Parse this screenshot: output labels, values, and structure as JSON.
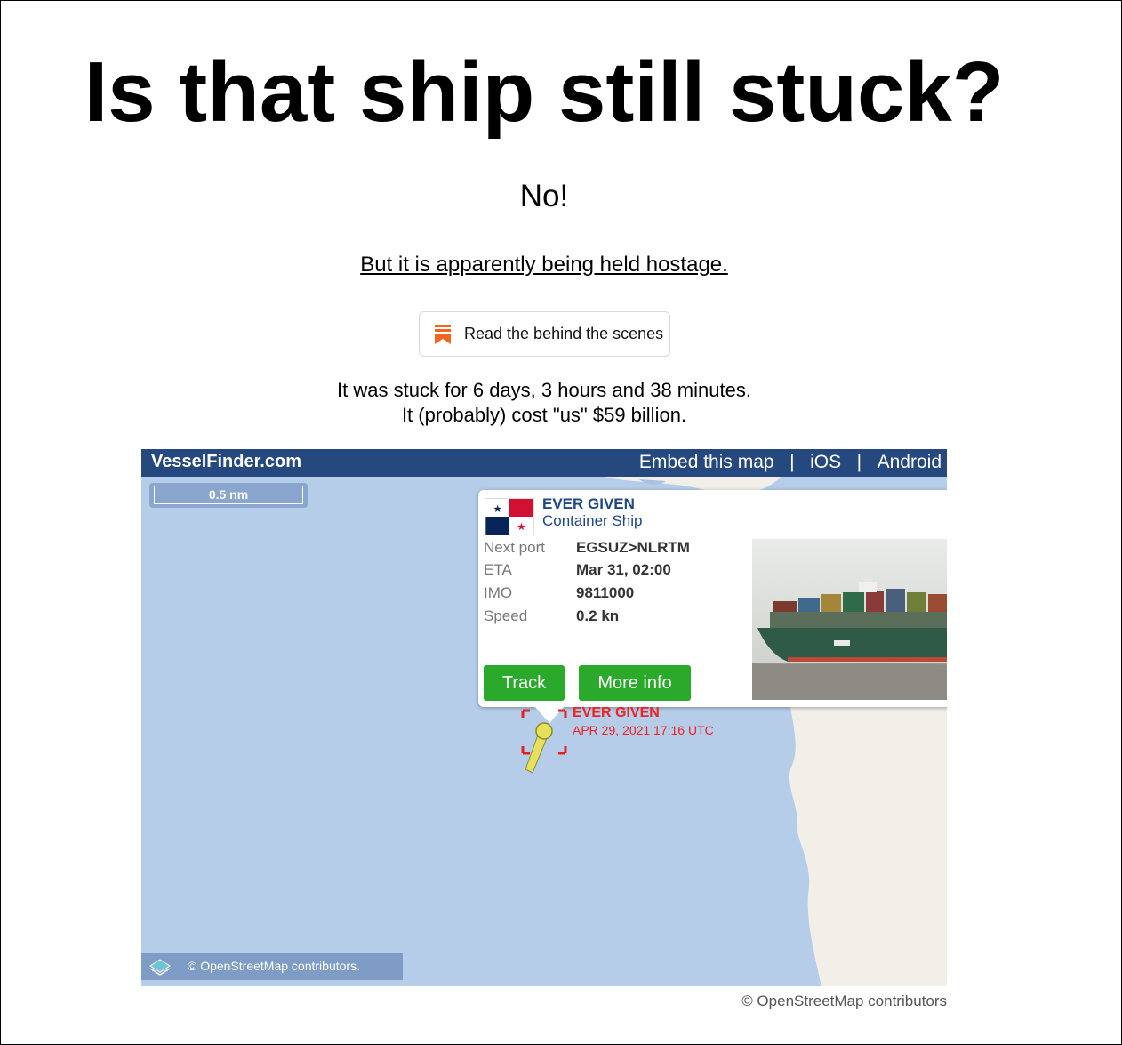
{
  "title": "Is that ship still stuck?",
  "answer": "No!",
  "hostage_link": "But it is apparently being held hostage.",
  "behind_scenes_button": "Read the behind the scenes",
  "stats": {
    "line1": "It was stuck for 6 days, 3 hours and 38 minutes.",
    "line2": "It (probably) cost \"us\" $59 billion."
  },
  "map": {
    "brand": "VesselFinder.com",
    "links": [
      "Embed this map",
      "|",
      "iOS",
      "|",
      "Android"
    ],
    "scale": "0.5 nm",
    "attribution_inside": "© OpenStreetMap contributors.",
    "popup": {
      "name": "EVER GIVEN",
      "type": "Container Ship",
      "rows": [
        {
          "key": "Next port",
          "value": "EGSUZ>NLRTM"
        },
        {
          "key": "ETA",
          "value": "Mar 31, 02:00"
        },
        {
          "key": "IMO",
          "value": "9811000"
        },
        {
          "key": "Speed",
          "value": "0.2 kn"
        }
      ],
      "track_label": "Track",
      "more_info_label": "More info"
    },
    "marker": {
      "name": "EVER GIVEN",
      "timestamp": "APR 29, 2021 17:16 UTC"
    }
  },
  "attribution_outside": "© OpenStreetMap contributors",
  "colors": {
    "map_header": "#25497f",
    "sea": "#b5cde9",
    "land": "#f2efe9",
    "button_green": "#2aa92a",
    "marker_red": "#e22222",
    "bookmark_orange": "#f26522"
  },
  "icons": [
    "bookmark-icon",
    "panama-flag",
    "layers-icon",
    "vessel-marker"
  ]
}
